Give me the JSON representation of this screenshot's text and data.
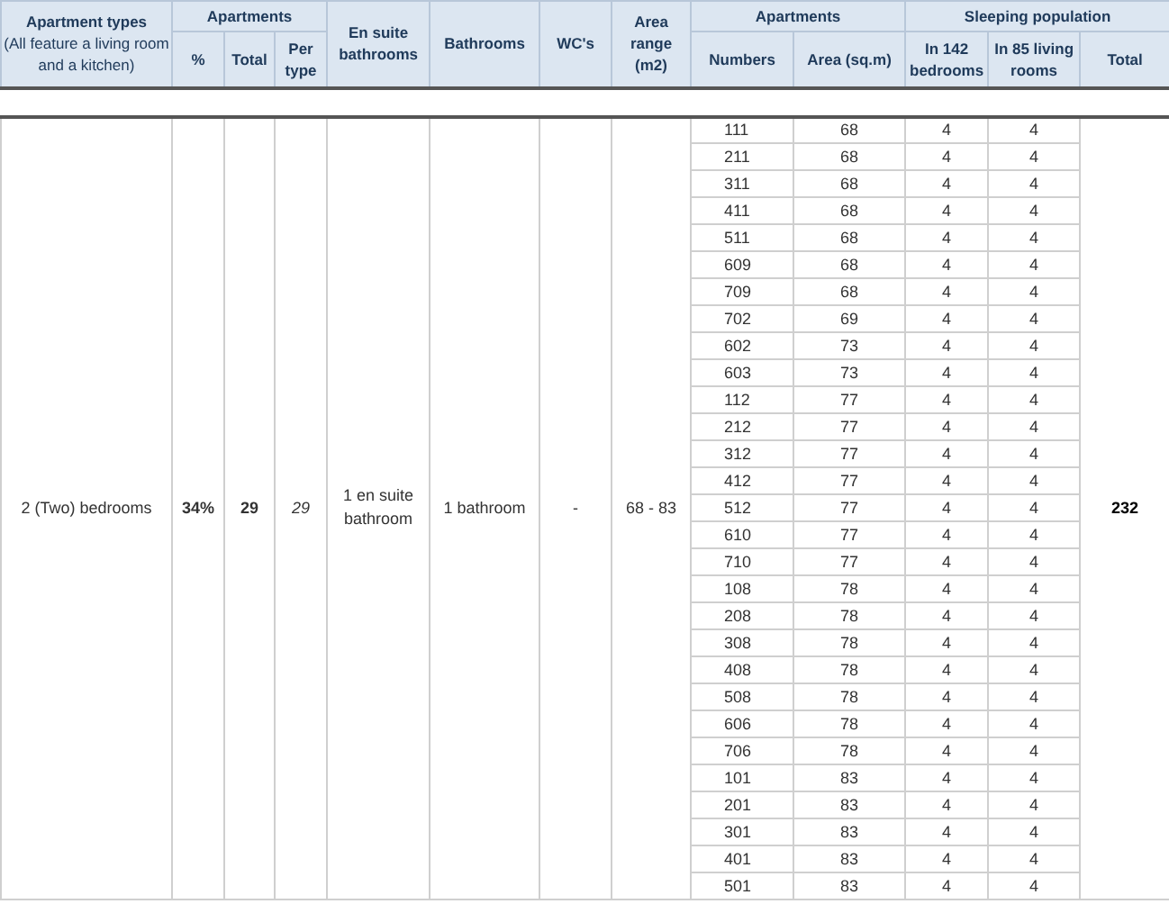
{
  "header": {
    "apartment_types": "Apartment types",
    "apartment_types_note": "(All feature a living room and a kitchen)",
    "apartments": "Apartments",
    "pct": "%",
    "total": "Total",
    "per_type": "Per type",
    "en_suite": "En suite bathrooms",
    "bathrooms": "Bathrooms",
    "wcs": "WC's",
    "area_range": "Area range (m2)",
    "apartments_2": "Apartments",
    "numbers": "Numbers",
    "area": "Area (sq.m)",
    "sleeping": "Sleeping population",
    "in_bedrooms": "In 142 bedrooms",
    "in_living": "In 85 living rooms",
    "sleeping_total": "Total"
  },
  "group": {
    "type": "2 (Two) bedrooms",
    "pct": "34%",
    "total": "29",
    "per_type": "29",
    "en_suite": "1 en suite bathroom",
    "bathrooms": "1 bathroom",
    "wcs": "-",
    "area_range": "68 - 83",
    "sleeping_total": "232"
  },
  "rows": [
    [
      "111",
      "68",
      "4",
      "4"
    ],
    [
      "211",
      "68",
      "4",
      "4"
    ],
    [
      "311",
      "68",
      "4",
      "4"
    ],
    [
      "411",
      "68",
      "4",
      "4"
    ],
    [
      "511",
      "68",
      "4",
      "4"
    ],
    [
      "609",
      "68",
      "4",
      "4"
    ],
    [
      "709",
      "68",
      "4",
      "4"
    ],
    [
      "702",
      "69",
      "4",
      "4"
    ],
    [
      "602",
      "73",
      "4",
      "4"
    ],
    [
      "603",
      "73",
      "4",
      "4"
    ],
    [
      "112",
      "77",
      "4",
      "4"
    ],
    [
      "212",
      "77",
      "4",
      "4"
    ],
    [
      "312",
      "77",
      "4",
      "4"
    ],
    [
      "412",
      "77",
      "4",
      "4"
    ],
    [
      "512",
      "77",
      "4",
      "4"
    ],
    [
      "610",
      "77",
      "4",
      "4"
    ],
    [
      "710",
      "77",
      "4",
      "4"
    ],
    [
      "108",
      "78",
      "4",
      "4"
    ],
    [
      "208",
      "78",
      "4",
      "4"
    ],
    [
      "308",
      "78",
      "4",
      "4"
    ],
    [
      "408",
      "78",
      "4",
      "4"
    ],
    [
      "508",
      "78",
      "4",
      "4"
    ],
    [
      "606",
      "78",
      "4",
      "4"
    ],
    [
      "706",
      "78",
      "4",
      "4"
    ],
    [
      "101",
      "83",
      "4",
      "4"
    ],
    [
      "201",
      "83",
      "4",
      "4"
    ],
    [
      "301",
      "83",
      "4",
      "4"
    ],
    [
      "401",
      "83",
      "4",
      "4"
    ],
    [
      "501",
      "83",
      "4",
      "4"
    ]
  ]
}
